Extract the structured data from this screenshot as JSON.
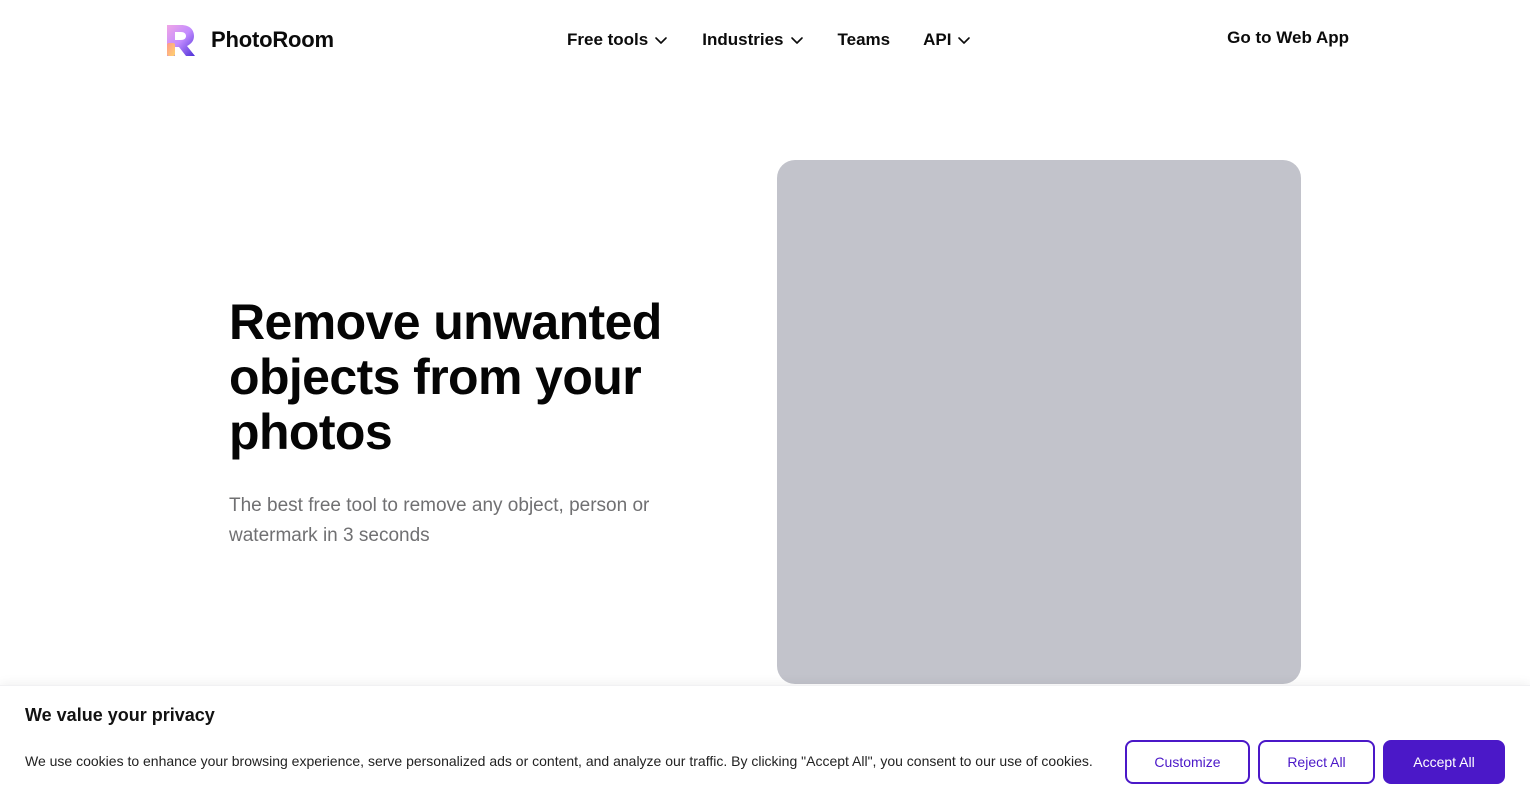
{
  "header": {
    "brand_name": "PhotoRoom",
    "nav": [
      {
        "label": "Free tools",
        "has_dropdown": true
      },
      {
        "label": "Industries",
        "has_dropdown": true
      },
      {
        "label": "Teams",
        "has_dropdown": false
      },
      {
        "label": "API",
        "has_dropdown": true
      }
    ],
    "cta_label": "Go to Web App"
  },
  "hero": {
    "title_lines": [
      "Remove unwanted",
      "objects from your",
      "photos"
    ],
    "subtitle_lines": [
      "The best free tool to remove any object, person or",
      "watermark in 3 seconds"
    ],
    "image_placeholder_color": "#c2c3cb"
  },
  "cookie_banner": {
    "title": "We value your privacy",
    "text": "We use cookies to enhance your browsing experience, serve personalized ads or content, and analyze our traffic. By clicking \"Accept All\", you consent to our use of cookies.",
    "buttons": {
      "customize": "Customize",
      "reject": "Reject All",
      "accept": "Accept All"
    }
  },
  "colors": {
    "accent": "#4b18c8",
    "text": "#0b0b0b",
    "muted_text": "#707072"
  },
  "icons": [
    "photoroom-logo-icon",
    "chevron-down-icon"
  ]
}
